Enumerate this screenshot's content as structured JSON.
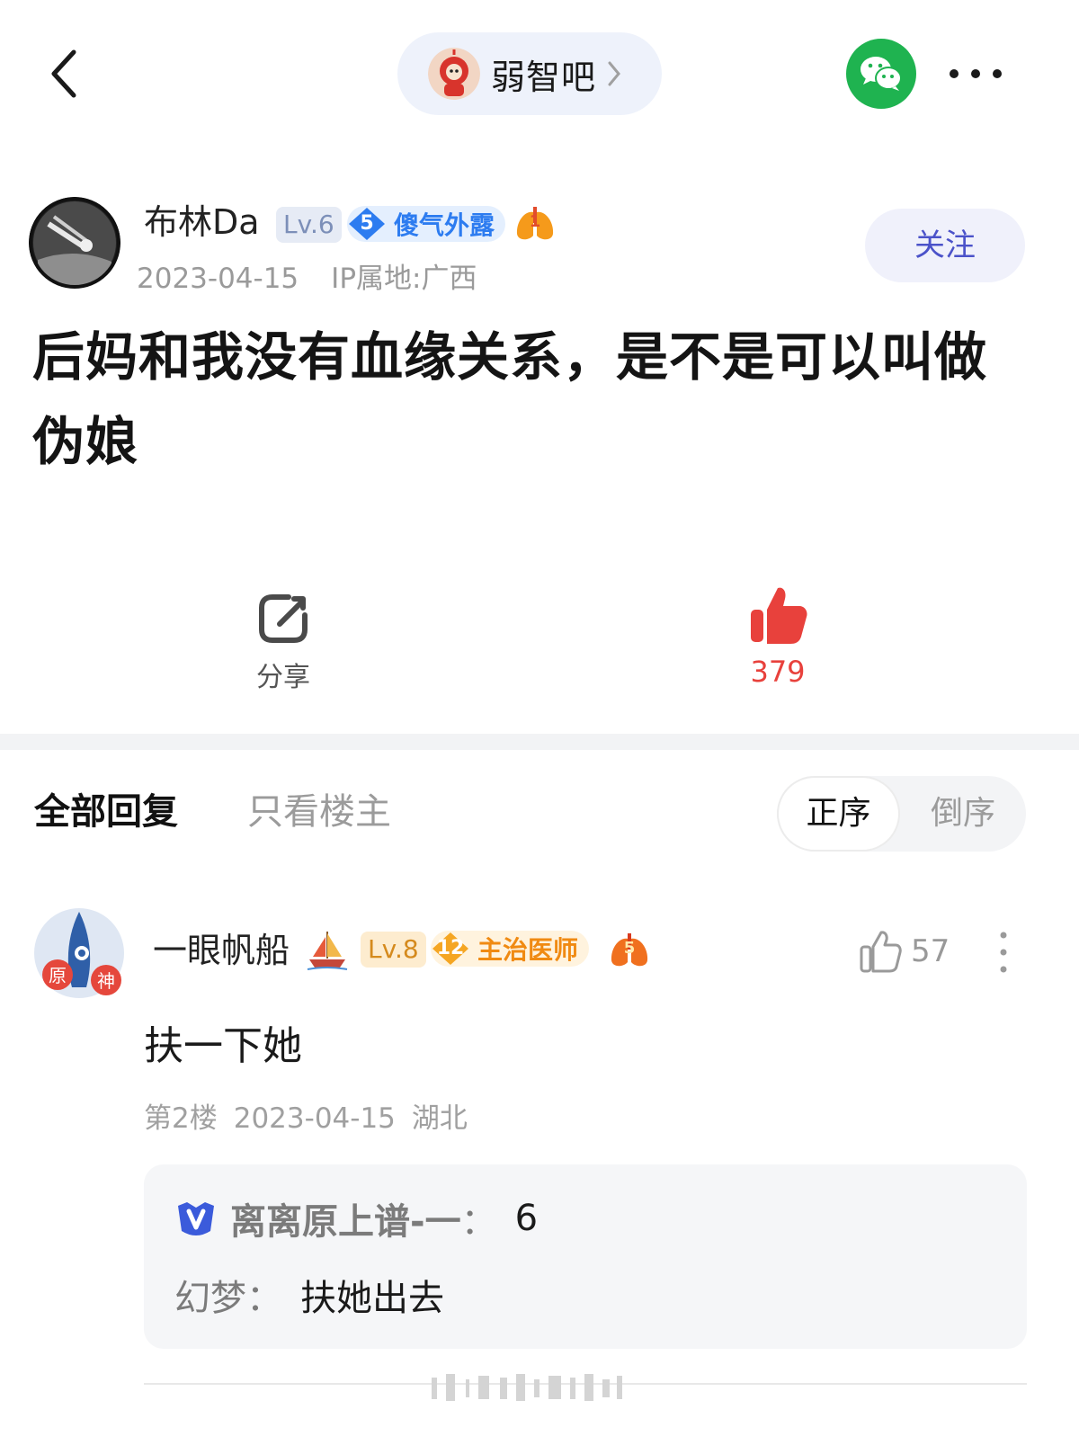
{
  "forum": {
    "name": "弱智吧"
  },
  "post": {
    "author": "布林Da",
    "level": "Lv.6",
    "title_badge_num": "5",
    "title_badge_text": "傻气外露",
    "lung_num": "1",
    "date": "2023-04-15",
    "ip": "IP属地:广西",
    "follow_label": "关注",
    "title": "后妈和我没有血缘关系，是不是可以叫做伪娘"
  },
  "actions": {
    "share_label": "分享",
    "like_count": "379"
  },
  "tabs": {
    "all": "全部回复",
    "op_only": "只看楼主",
    "sort_asc": "正序",
    "sort_desc": "倒序"
  },
  "reply": {
    "author": "一眼帆船",
    "level": "Lv.8",
    "title_badge_num": "12",
    "title_badge_text": "主治医师",
    "lung_num": "5",
    "avatar_text": [
      "原",
      "神"
    ],
    "like_count": "57",
    "text": "扶一下她",
    "floor": "第2楼",
    "date": "2023-04-15",
    "location": "湖北",
    "sub_replies": [
      {
        "name": "离离原上谱-一",
        "sep": "：",
        "content": "6"
      },
      {
        "name": "幻梦",
        "sep": "：",
        "content": "扶她出去"
      }
    ]
  },
  "colors": {
    "accent": "#4b52c9",
    "like_red": "#e8413c",
    "wechat_green": "#1fb350",
    "badge_blue": "#2d7cf0",
    "badge_orange": "#f08a12"
  }
}
